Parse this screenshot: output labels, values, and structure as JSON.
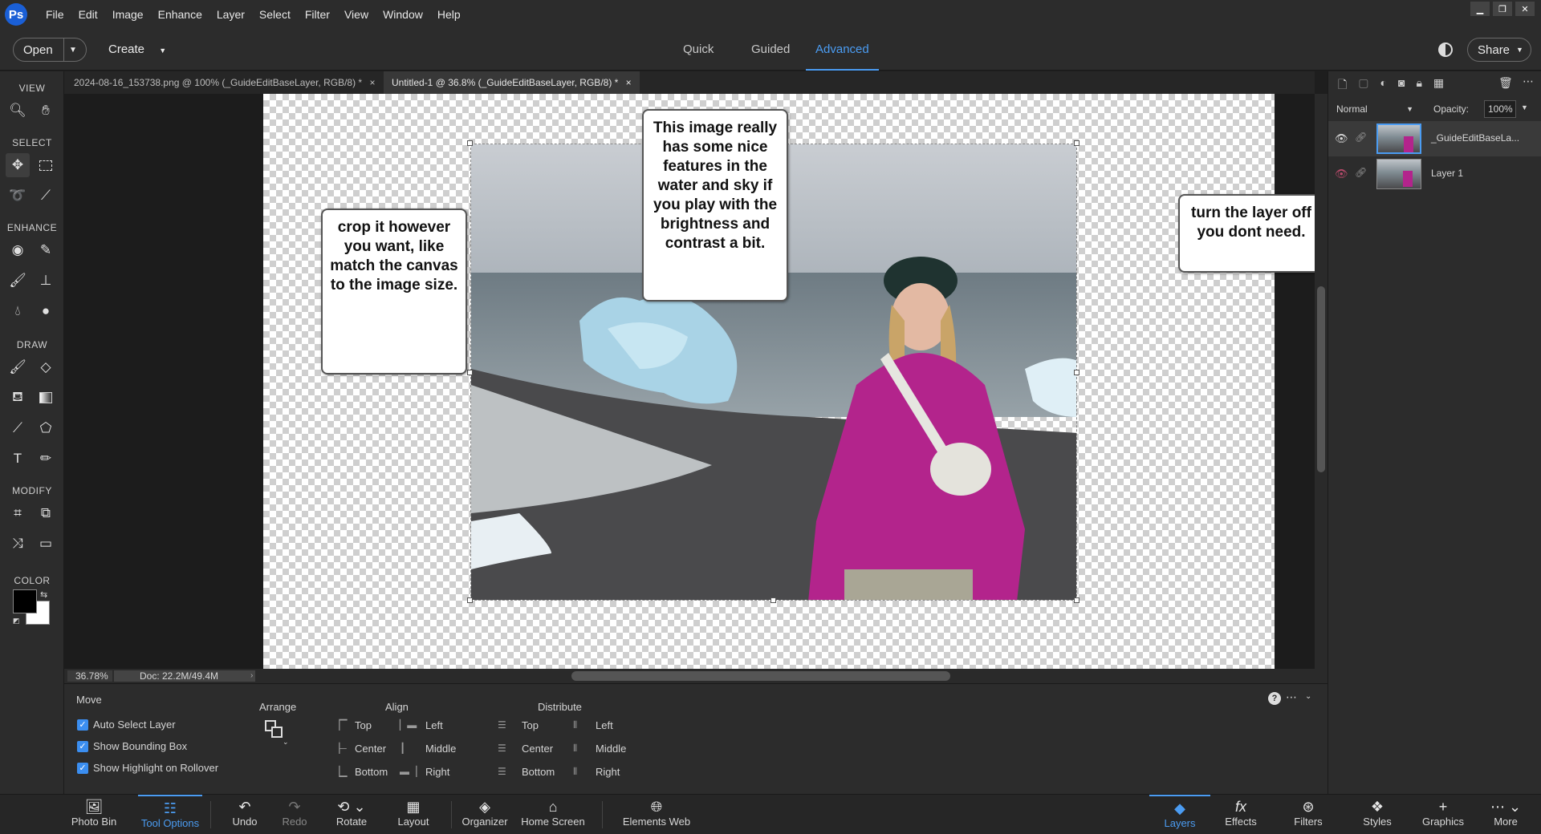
{
  "menubar": {
    "logo": "Ps",
    "items": [
      "File",
      "Edit",
      "Image",
      "Enhance",
      "Layer",
      "Select",
      "Filter",
      "View",
      "Window",
      "Help"
    ]
  },
  "topbar": {
    "open_label": "Open",
    "create_label": "Create",
    "modes": [
      "Quick",
      "Guided",
      "Advanced"
    ],
    "active_mode": "Advanced",
    "share_label": "Share"
  },
  "toolbar": {
    "sections": {
      "view": "VIEW",
      "select": "SELECT",
      "enhance": "ENHANCE",
      "draw": "DRAW",
      "modify": "MODIFY",
      "color": "COLOR"
    },
    "foreground_color": "#000000",
    "background_color": "#ffffff"
  },
  "doc_tabs": [
    {
      "label": "2024-08-16_153738.png @ 100% (_GuideEditBaseLayer, RGB/8) *",
      "close": "×"
    },
    {
      "label": "Untitled-1 @ 36.8% (_GuideEditBaseLayer, RGB/8) *",
      "close": "×"
    }
  ],
  "callouts": {
    "crop": "crop it however you want, like match the canvas to the image size.",
    "image": "This image really has some nice features in the water and sky if you play with the brightness and contrast a bit.",
    "layer": "turn the layer off you dont need."
  },
  "status": {
    "zoom": "36.78%",
    "doc": "Doc: 22.2M/49.4M"
  },
  "layers_panel": {
    "blend_mode": "Normal",
    "opacity_label": "Opacity:",
    "opacity_value": "100%",
    "layers": [
      {
        "name": "_GuideEditBaseLa...",
        "visible": true,
        "selected": true
      },
      {
        "name": "Layer 1",
        "visible": false,
        "selected": false
      }
    ]
  },
  "tool_options": {
    "tool_name": "Move",
    "checkboxes": [
      "Auto Select Layer",
      "Show Bounding Box",
      "Show Highlight on Rollover"
    ],
    "arrange_label": "Arrange",
    "align_label": "Align",
    "distribute_label": "Distribute",
    "align": {
      "col1": [
        "Top",
        "Center",
        "Bottom"
      ],
      "col2": [
        "Left",
        "Middle",
        "Right"
      ]
    },
    "distribute": {
      "col1": [
        "Top",
        "Center",
        "Bottom"
      ],
      "col2": [
        "Left",
        "Middle",
        "Right"
      ]
    }
  },
  "bottombar": {
    "left": [
      "Photo Bin",
      "Tool Options",
      "Undo",
      "Redo",
      "Rotate",
      "Layout",
      "Organizer",
      "Home Screen",
      "Elements Web"
    ],
    "right": [
      "Layers",
      "Effects",
      "Filters",
      "Styles",
      "Graphics",
      "More"
    ]
  },
  "colors": {
    "accent": "#4b9cf2",
    "panel": "#2c2c2c",
    "checkbox": "#3b8ef0"
  }
}
